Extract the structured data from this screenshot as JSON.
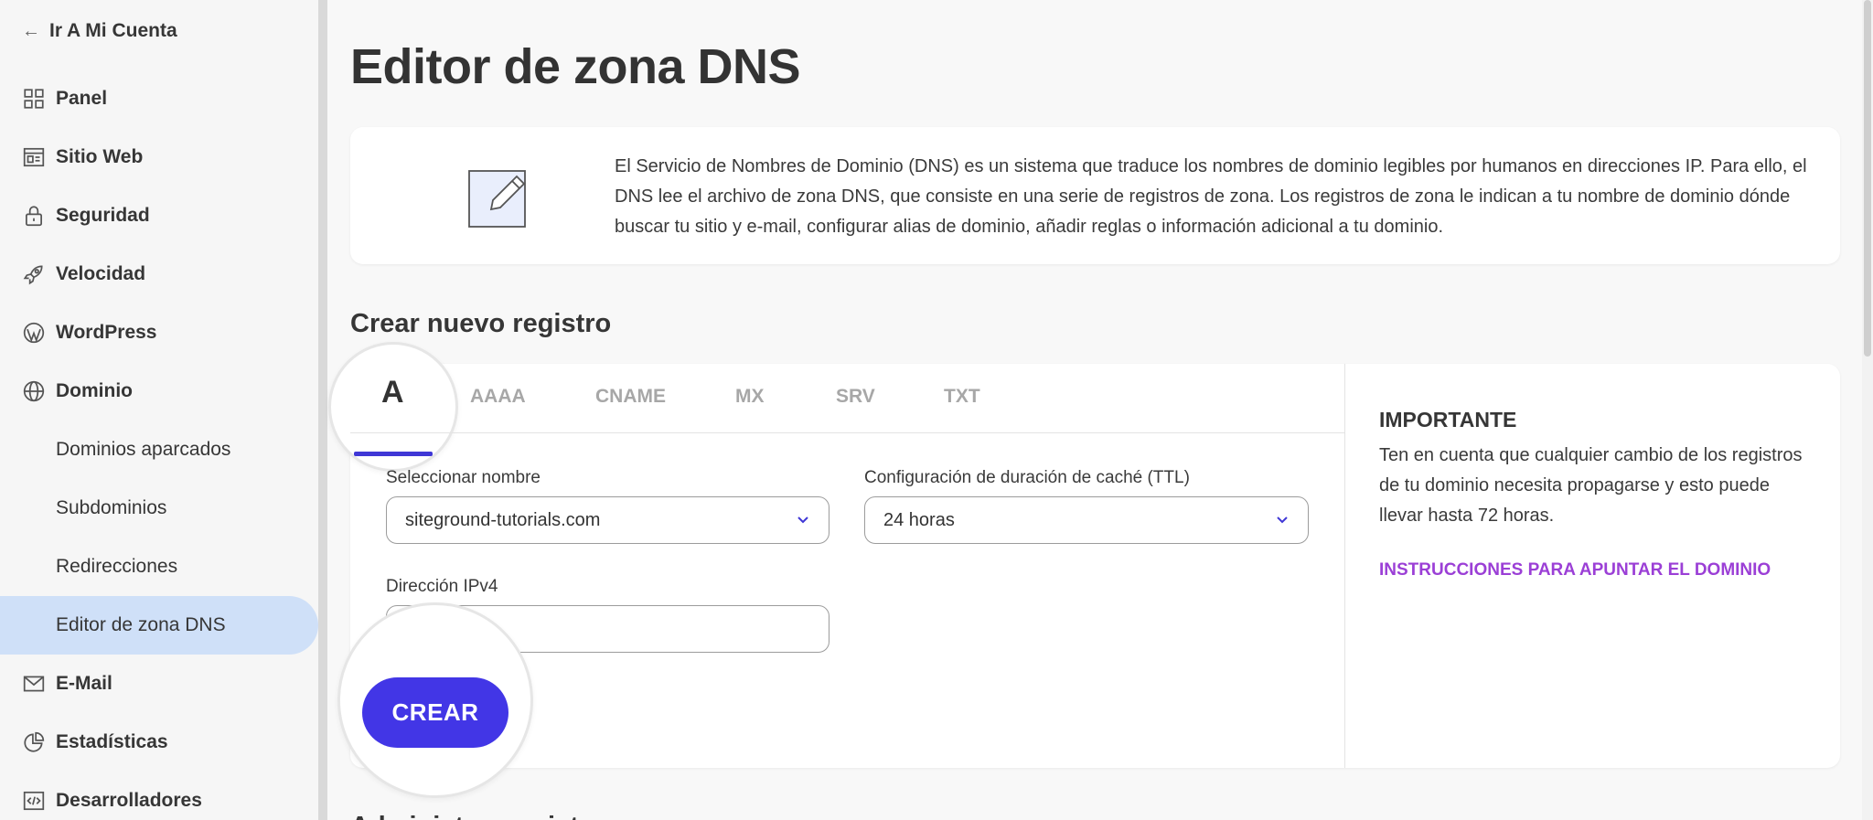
{
  "sidebar": {
    "back_label": "Ir A Mi Cuenta",
    "items": [
      {
        "label": "Panel",
        "icon": "grid-icon"
      },
      {
        "label": "Sitio Web",
        "icon": "website-icon"
      },
      {
        "label": "Seguridad",
        "icon": "lock-icon"
      },
      {
        "label": "Velocidad",
        "icon": "rocket-icon"
      },
      {
        "label": "WordPress",
        "icon": "wordpress-icon"
      },
      {
        "label": "Dominio",
        "icon": "globe-icon"
      },
      {
        "label": "E-Mail",
        "icon": "mail-icon"
      },
      {
        "label": "Estadísticas",
        "icon": "pie-chart-icon"
      },
      {
        "label": "Desarrolladores",
        "icon": "code-icon"
      }
    ],
    "domain_subitems": [
      "Dominios aparcados",
      "Subdominios",
      "Redirecciones",
      "Editor de zona DNS"
    ],
    "active_subitem": "Editor de zona DNS"
  },
  "page": {
    "title": "Editor de zona DNS",
    "info_text": "El Servicio de Nombres de Dominio (DNS) es un sistema que traduce los nombres de dominio legibles por humanos en direcciones IP. Para ello, el DNS lee el archivo de zona DNS, que consiste en una serie de registros de zona. Los registros de zona le indican a tu nombre de dominio dónde buscar tu sitio y e-mail, configurar alias de dominio, añadir reglas o información adicional a tu dominio.",
    "section_title": "Crear nuevo registro",
    "next_section_partial": "Administrar registros"
  },
  "form": {
    "tabs": [
      "A",
      "AAAA",
      "CNAME",
      "MX",
      "SRV",
      "TXT"
    ],
    "active_tab": "A",
    "name_label": "Seleccionar nombre",
    "name_value": "siteground-tutorials.com",
    "ttl_label": "Configuración de duración de caché (TTL)",
    "ttl_value": "24 horas",
    "ipv4_label": "Dirección IPv4",
    "ipv4_value": "",
    "create_button": "CREAR"
  },
  "important": {
    "title": "IMPORTANTE",
    "text": "Ten en cuenta que cualquier cambio de los registros de tu dominio necesita propagarse y esto puede llevar hasta 72 horas.",
    "link": "INSTRUCCIONES PARA APUNTAR EL DOMINIO"
  },
  "colors": {
    "accent": "#4236e6",
    "link": "#9b3fd6",
    "active_nav_bg": "#cfe0f8"
  }
}
